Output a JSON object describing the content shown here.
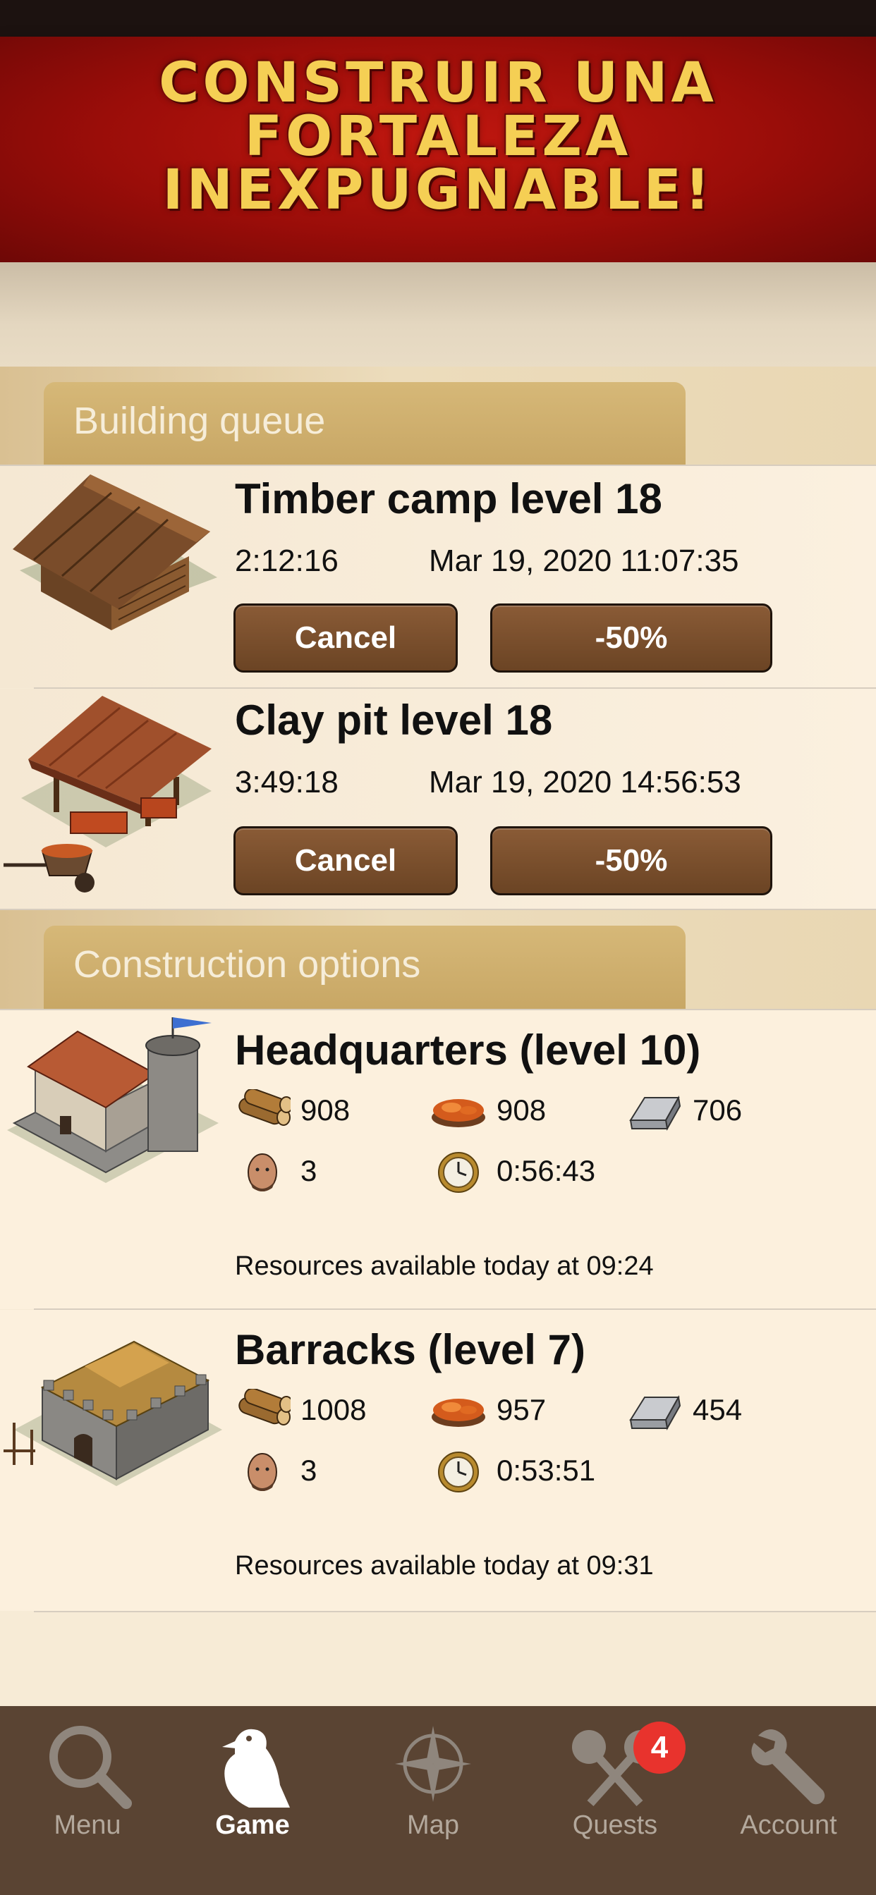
{
  "banner": {
    "line1": "CONSTRUIR UNA",
    "line2": "FORTALEZA",
    "line3": "INEXPUGNABLE!"
  },
  "building_queue": {
    "title": "Building queue",
    "items": [
      {
        "name": "Timber camp level 18",
        "duration": "2:12:16",
        "finish": "Mar 19, 2020  11:07:35",
        "cancel_label": "Cancel",
        "speedup_label": "-50%",
        "image": "timber-camp-icon"
      },
      {
        "name": "Clay pit level 18",
        "duration": "3:49:18",
        "finish": "Mar 19, 2020  14:56:53",
        "cancel_label": "Cancel",
        "speedup_label": "-50%",
        "image": "clay-pit-icon"
      }
    ]
  },
  "construction_options": {
    "title": "Construction options",
    "items": [
      {
        "name": "Headquarters (level 10)",
        "wood": "908",
        "clay": "908",
        "iron": "706",
        "population": "3",
        "time": "0:56:43",
        "note": "Resources available today at 09:24",
        "image": "headquarters-icon"
      },
      {
        "name": "Barracks (level 7)",
        "wood": "1008",
        "clay": "957",
        "iron": "454",
        "population": "3",
        "time": "0:53:51",
        "note": "Resources available today at 09:31",
        "image": "barracks-icon"
      }
    ]
  },
  "tabbar": {
    "items": [
      {
        "label": "Menu",
        "icon": "magnifier-icon",
        "active": false
      },
      {
        "label": "Game",
        "icon": "raven-icon",
        "active": true
      },
      {
        "label": "Map",
        "icon": "compass-icon",
        "active": false
      },
      {
        "label": "Quests",
        "icon": "quests-icon",
        "active": false,
        "badge": "4"
      },
      {
        "label": "Account",
        "icon": "wrench-icon",
        "active": false
      }
    ]
  },
  "colors": {
    "banner_red": "#a50f0b",
    "banner_text": "#f5cf54",
    "button_brown": "#7a4e2d",
    "tab_bg": "#5a4433",
    "badge_red": "#e8332d"
  }
}
